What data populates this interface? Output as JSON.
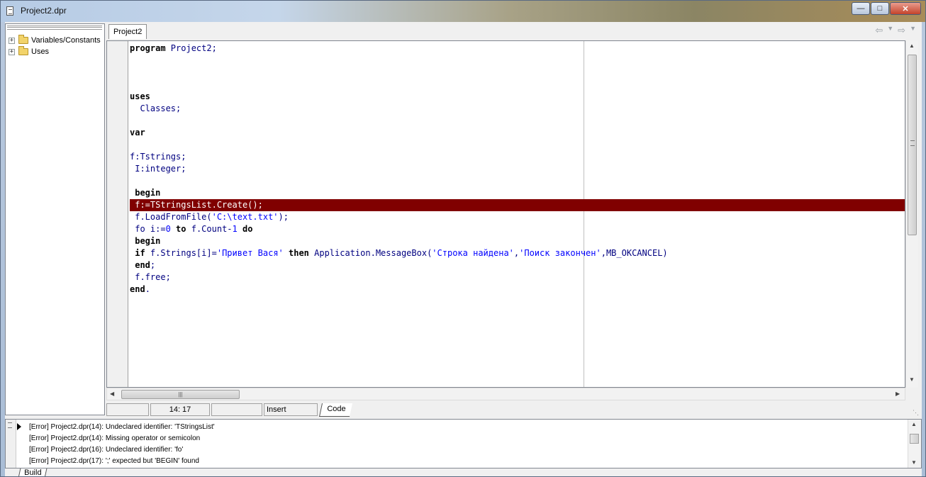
{
  "window": {
    "title": "Project2.dpr"
  },
  "tree": {
    "items": [
      {
        "label": "Variables/Constants"
      },
      {
        "label": "Uses"
      }
    ]
  },
  "editor": {
    "tab": "Project2",
    "lines": [
      [
        [
          "kw",
          "program"
        ],
        [
          "n",
          " Project2;"
        ]
      ],
      [],
      [],
      [],
      [
        [
          "kw",
          "uses"
        ]
      ],
      [
        [
          "n",
          "  Classes;"
        ]
      ],
      [],
      [
        [
          "kw",
          "var"
        ]
      ],
      [],
      [
        [
          "n",
          "f:Tstrings;"
        ]
      ],
      [
        [
          "n",
          " I:integer;"
        ]
      ],
      [],
      [
        [
          "kw",
          " begin"
        ]
      ],
      [
        [
          "n",
          " f:=TStringsList.Create();"
        ]
      ],
      [
        [
          "n",
          " f.LoadFromFile("
        ],
        [
          "str",
          "'C:\\text.txt'"
        ],
        [
          "n",
          ");"
        ]
      ],
      [
        [
          "n",
          " fo i:="
        ],
        [
          "num",
          "0"
        ],
        [
          "n",
          " "
        ],
        [
          "kw",
          "to"
        ],
        [
          "n",
          " f.Count-"
        ],
        [
          "num",
          "1"
        ],
        [
          "n",
          " "
        ],
        [
          "kw",
          "do"
        ]
      ],
      [
        [
          "kw",
          " begin"
        ]
      ],
      [
        [
          "n",
          " "
        ],
        [
          "kw",
          "if"
        ],
        [
          "n",
          " f.Strings[i]="
        ],
        [
          "str",
          "'Привет Вася'"
        ],
        [
          "n",
          " "
        ],
        [
          "kw",
          "then"
        ],
        [
          "n",
          " Application.MessageBox("
        ],
        [
          "str",
          "'Строка найдена'"
        ],
        [
          "n",
          ","
        ],
        [
          "str",
          "'Поиск закончен'"
        ],
        [
          "n",
          ",MB_OKCANCEL)"
        ]
      ],
      [
        [
          "kw",
          " end"
        ],
        [
          "n",
          ";"
        ]
      ],
      [
        [
          "n",
          " f.free;"
        ]
      ],
      [
        [
          "kw",
          "end"
        ],
        [
          "n",
          "."
        ]
      ]
    ],
    "error_line_index": 13
  },
  "status": {
    "position": "14:  17",
    "mode": "Insert",
    "view_tab": "Code"
  },
  "messages": {
    "items": [
      "[Error] Project2.dpr(14): Undeclared identifier: 'TStringsList'",
      "[Error] Project2.dpr(14): Missing operator or semicolon",
      "[Error] Project2.dpr(16): Undeclared identifier: 'fo'",
      "[Error] Project2.dpr(17): ';' expected but 'BEGIN' found"
    ],
    "tab": "Build"
  },
  "icons": {
    "minimize": "minimize-icon",
    "maximize": "maximize-icon",
    "close": "close-icon",
    "back": "back-arrow-icon",
    "forward": "forward-arrow-icon",
    "folder": "folder-icon",
    "expand": "expand-plus-icon"
  },
  "colors": {
    "error_line_bg": "#800000",
    "string_literal": "#0000ff",
    "identifier": "#000080"
  }
}
